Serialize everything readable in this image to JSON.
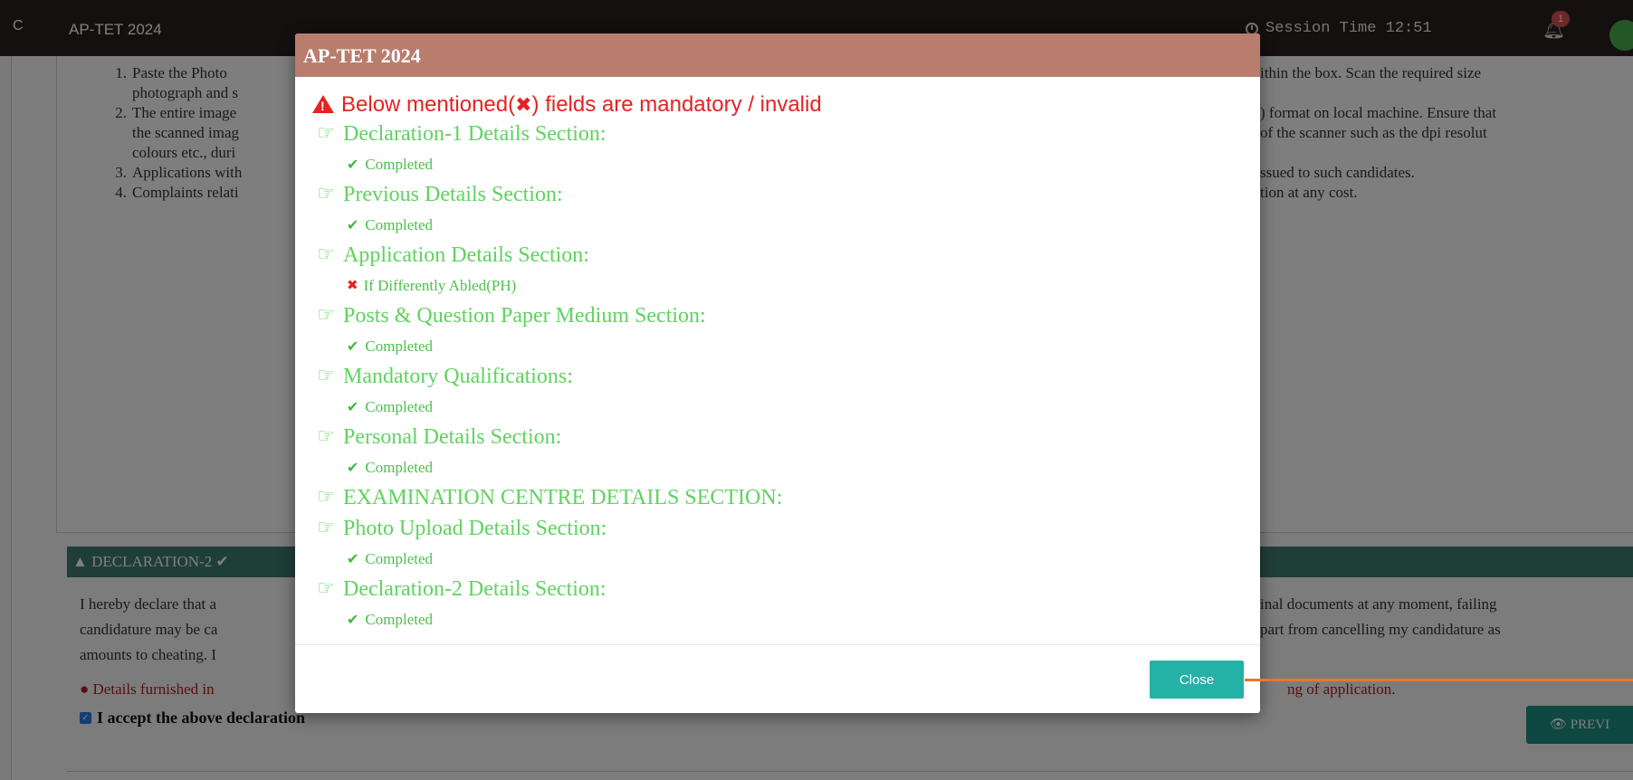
{
  "topbar": {
    "logo_fragment": "C",
    "app_title": "AP-TET 2024",
    "session_time": "Session Time 12:51",
    "notification_count": "1"
  },
  "instructions": [
    {
      "num": "1.",
      "lines": [
        "Paste the Photo",
        "ithin the box. Scan the required size"
      ],
      "cont": [
        "photograph and s"
      ]
    },
    {
      "num": "2.",
      "lines": [
        "The entire image",
        ") format on local machine. Ensure that"
      ],
      "cont": [
        "the scanned imag",
        "of the scanner such as the dpi resolut",
        "colours etc., duri"
      ]
    },
    {
      "num": "3.",
      "lines": [
        "Applications with",
        "ssued to such candidates."
      ],
      "cont": []
    },
    {
      "num": "4.",
      "lines": [
        "Complaints relati",
        "tion at any cost."
      ],
      "cont": []
    }
  ],
  "declaration2": {
    "header": "DECLARATION-2",
    "text_left": [
      "I hereby declare that a",
      "candidature may be ca",
      "amounts to cheating. I"
    ],
    "text_right": [
      "inal documents at any moment, failing",
      "part from cancelling my candidature as"
    ],
    "warning_left": "Details furnished in",
    "warning_right": "ng of application.",
    "accept_label": "I accept the above declaration",
    "preview_label": "PREVI"
  },
  "modal": {
    "title": "AP-TET 2024",
    "alert": {
      "prefix": "Below mentioned(",
      "suffix": ") fields are mandatory / invalid"
    },
    "sections": [
      {
        "title": "Declaration-1 Details Section:",
        "status": "Completed",
        "ok": true
      },
      {
        "title": "Previous Details Section:",
        "status": "Completed",
        "ok": true
      },
      {
        "title": "Application Details Section:",
        "status": "If Differently Abled(PH)",
        "ok": false
      },
      {
        "title": "Posts & Question Paper Medium Section:",
        "status": "Completed",
        "ok": true
      },
      {
        "title": "Mandatory Qualifications:",
        "status": "Completed",
        "ok": true
      },
      {
        "title": "Personal Details Section:",
        "status": "Completed",
        "ok": true
      },
      {
        "title": "EXAMINATION CENTRE DETAILS SECTION:",
        "status": "",
        "ok": true
      },
      {
        "title": "Photo Upload Details Section:",
        "status": "Completed",
        "ok": true
      },
      {
        "title": "Declaration-2 Details Section:",
        "status": "Completed",
        "ok": true
      }
    ],
    "close_label": "Close"
  },
  "colors": {
    "topbar": "#2b2120",
    "modal_header": "#b97d6e",
    "success_green": "#5fd35f",
    "error_red": "#e62222",
    "close_button": "#24b1a6",
    "declaration_header": "#3e7d6e"
  }
}
